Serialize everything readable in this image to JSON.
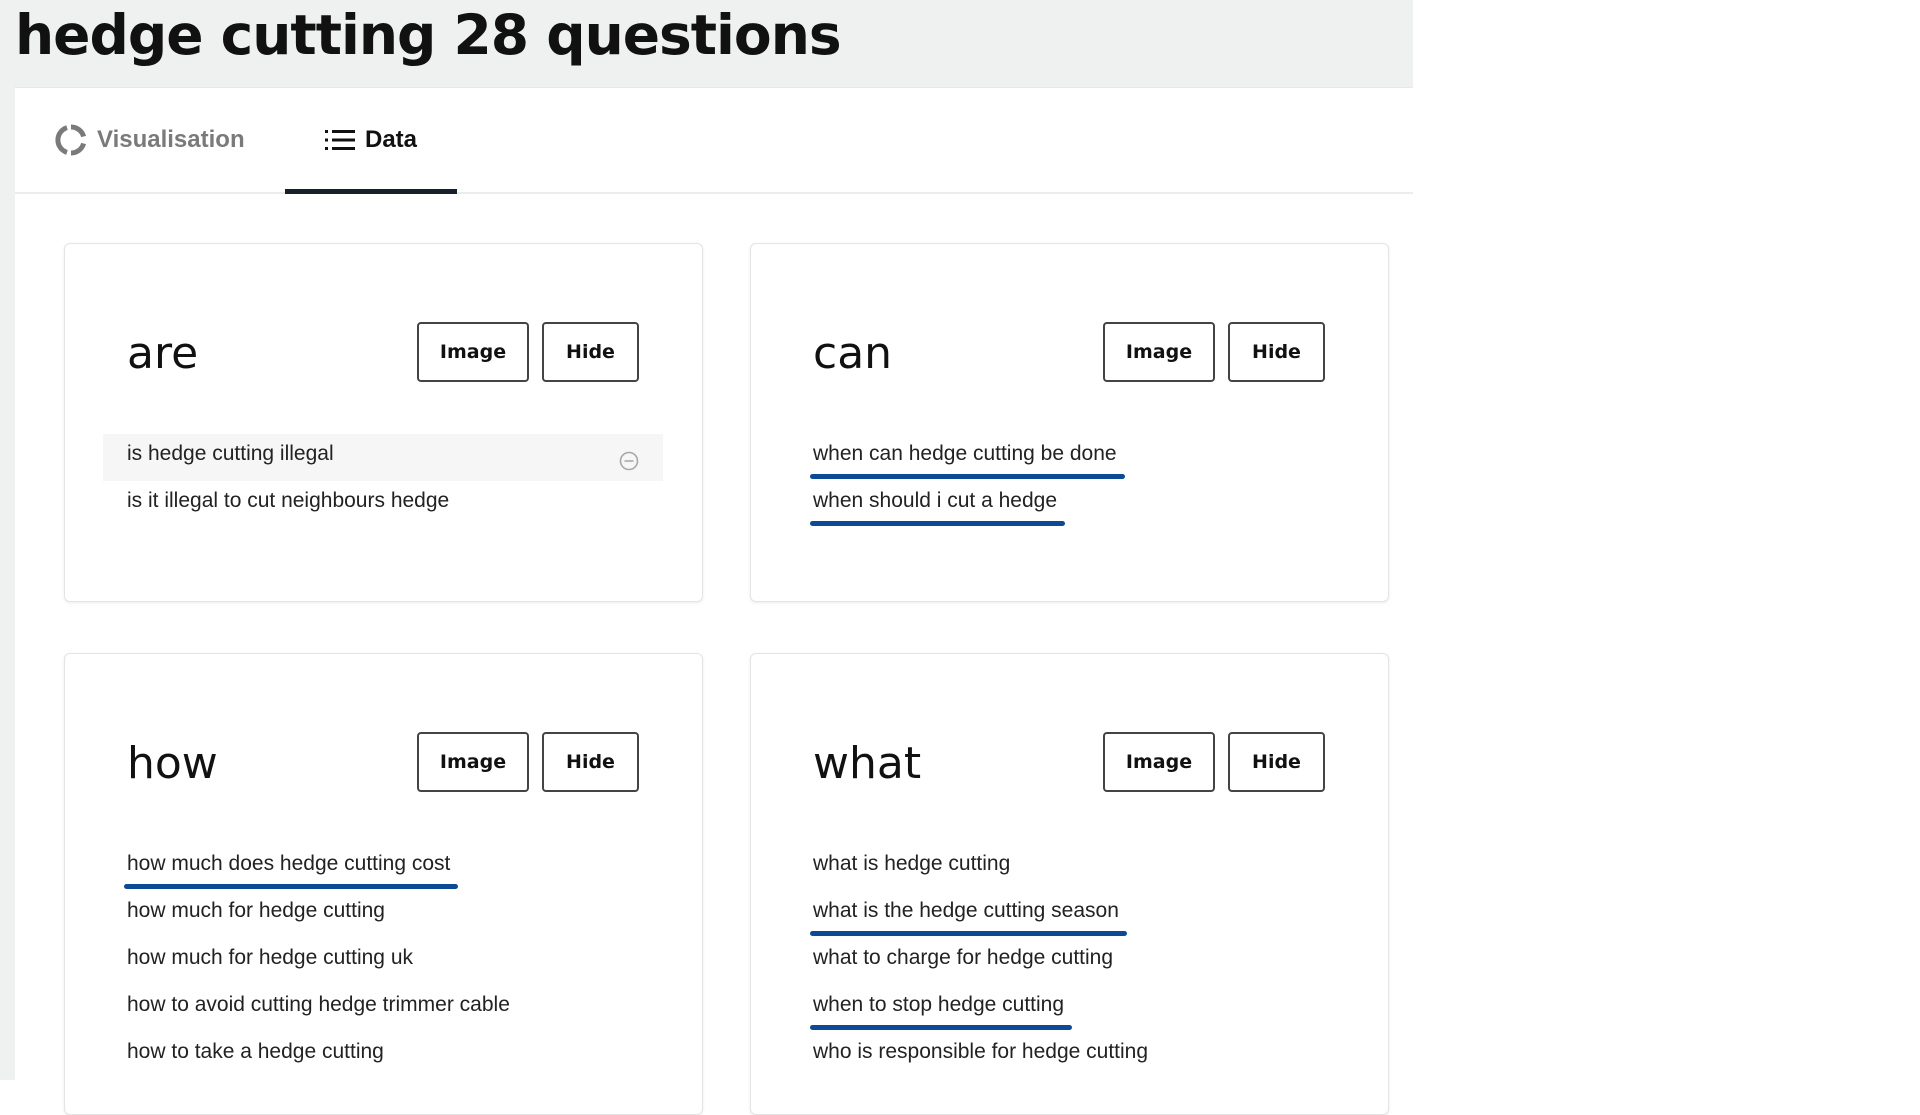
{
  "page": {
    "title": "hedge cutting 28 questions"
  },
  "tabs": [
    {
      "label": "Visualisation",
      "icon": "circle-segments-icon",
      "active": false
    },
    {
      "label": "Data",
      "icon": "list-icon",
      "active": true
    }
  ],
  "colors": {
    "highlight_underline": "#0d4a96",
    "page_bg": "#eff0f0",
    "active_tab_underline": "#15202b"
  },
  "cards": [
    {
      "heading": "are",
      "image_label": "Image",
      "hide_label": "Hide",
      "questions": [
        {
          "text": "is hedge cutting illegal",
          "marked": false,
          "hovered": true
        },
        {
          "text": "is it illegal to cut neighbours hedge",
          "marked": false
        }
      ]
    },
    {
      "heading": "can",
      "image_label": "Image",
      "hide_label": "Hide",
      "questions": [
        {
          "text": "when can hedge cutting be done",
          "marked": true
        },
        {
          "text": "when should i cut a hedge",
          "marked": true
        }
      ]
    },
    {
      "heading": "how",
      "image_label": "Image",
      "hide_label": "Hide",
      "questions": [
        {
          "text": "how much does hedge cutting cost",
          "marked": true
        },
        {
          "text": "how much for hedge cutting",
          "marked": false
        },
        {
          "text": "how much for hedge cutting uk",
          "marked": false
        },
        {
          "text": "how to avoid cutting hedge trimmer cable",
          "marked": false
        },
        {
          "text": "how to take a hedge cutting",
          "marked": false
        }
      ]
    },
    {
      "heading": "what",
      "image_label": "Image",
      "hide_label": "Hide",
      "questions": [
        {
          "text": "what is hedge cutting",
          "marked": false
        },
        {
          "text": "what is the hedge cutting season",
          "marked": true
        },
        {
          "text": "what to charge for hedge cutting",
          "marked": false
        },
        {
          "text": "when to stop hedge cutting",
          "marked": true
        },
        {
          "text": "who is responsible for hedge cutting",
          "marked": false
        }
      ]
    }
  ]
}
